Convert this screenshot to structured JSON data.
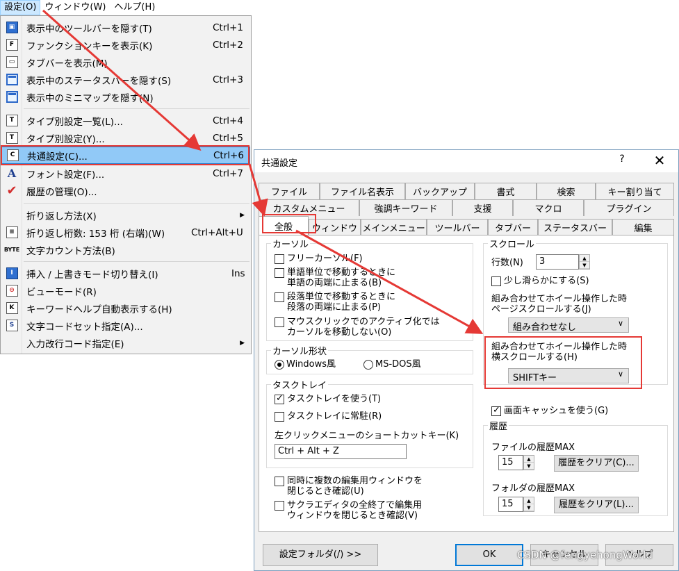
{
  "menubar": {
    "items": [
      "設定(O)",
      "ウィンドウ(W)",
      "ヘルプ(H)"
    ]
  },
  "menu": {
    "items": [
      {
        "label": "表示中のツールバーを隠す(T)",
        "shortcut": "Ctrl+1",
        "icon": "toolbar-icon"
      },
      {
        "label": "ファンクションキーを表示(K)",
        "shortcut": "Ctrl+2",
        "icon": "function-key-icon"
      },
      {
        "label": "タブバーを表示(M)",
        "shortcut": "",
        "icon": "tabbar-icon"
      },
      {
        "label": "表示中のステータスバーを隠す(S)",
        "shortcut": "Ctrl+3",
        "icon": "statusbar-icon"
      },
      {
        "label": "表示中のミニマップを隠す(N)",
        "shortcut": "",
        "icon": "minimap-icon"
      },
      {
        "label": "タイプ別設定一覧(L)...",
        "shortcut": "Ctrl+4",
        "icon": "type-settings-list-icon"
      },
      {
        "label": "タイプ別設定(Y)...",
        "shortcut": "Ctrl+5",
        "icon": "type-settings-icon"
      },
      {
        "label": "共通設定(C)...",
        "shortcut": "Ctrl+6",
        "icon": "common-settings-icon"
      },
      {
        "label": "フォント設定(F)...",
        "shortcut": "Ctrl+7",
        "icon": "font-icon"
      },
      {
        "label": "履歴の管理(O)...",
        "shortcut": "",
        "icon": "checkmark-icon"
      },
      {
        "label": "折り返し方法(X)",
        "shortcut": "",
        "icon": ""
      },
      {
        "label": "折り返し桁数: 153 桁 (右端)(W)",
        "shortcut": "Ctrl+Alt+U",
        "icon": "wrap-column-icon"
      },
      {
        "label": "文字カウント方法(B)",
        "shortcut": "",
        "icon": "byte-icon"
      },
      {
        "label": "挿入 / 上書きモード切り替え(I)",
        "shortcut": "Ins",
        "icon": "insert-mode-icon"
      },
      {
        "label": "ビューモード(R)",
        "shortcut": "",
        "icon": "view-mode-icon"
      },
      {
        "label": "キーワードヘルプ自動表示する(H)",
        "shortcut": "",
        "icon": "keyword-help-icon"
      },
      {
        "label": "文字コードセット指定(A)...",
        "shortcut": "",
        "icon": "charset-icon"
      },
      {
        "label": "入力改行コード指定(E)",
        "shortcut": "",
        "icon": ""
      }
    ]
  },
  "dialog": {
    "title": "共通設定",
    "help": "?",
    "close": "✕",
    "tabs_row1": [
      "ファイル",
      "ファイル名表示",
      "バックアップ",
      "書式",
      "検索",
      "キー割り当て"
    ],
    "tabs_row2": [
      "カスタムメニュー",
      "強調キーワード",
      "支援",
      "マクロ",
      "プラグイン"
    ],
    "tabs_row3": [
      "全般",
      "ウィンドウ",
      "メインメニュー",
      "ツールバー",
      "タブバー",
      "ステータスバー",
      "編集"
    ],
    "cursor": {
      "legend": "カーソル",
      "free_cursor": "フリーカーソル(F)",
      "word_stop_1": "単語単位で移動するときに",
      "word_stop_2": "単語の両端に止まる(B)",
      "para_stop_1": "段落単位で移動するときに",
      "para_stop_2": "段落の両端に止まる(P)",
      "mouse_1": "マウスクリックでのアクティブ化では",
      "mouse_2": "カーソルを移動しない(O)"
    },
    "cursor_shape": {
      "legend": "カーソル形状",
      "windows": "Windows風",
      "msdos": "MS-DOS風"
    },
    "tasktray": {
      "legend": "タスクトレイ",
      "use": "タスクトレイを使う(T)",
      "resident": "タスクトレイに常駐(R)",
      "shortcut_label": "左クリックメニューのショートカットキー(K)",
      "shortcut_value": "Ctrl + Alt + Z"
    },
    "close_confirm_1": "同時に複数の編集用ウィンドウを",
    "close_confirm_2": "閉じるとき確認(U)",
    "exit_confirm_1": "サクラエディタの全終了で編集用",
    "exit_confirm_2": "ウィンドウを閉じるとき確認(V)",
    "scroll": {
      "legend": "スクロール",
      "lines_label": "行数(N)",
      "lines_value": "3",
      "smooth": "少し滑らかにする(S)",
      "page_label_1": "組み合わせてホイール操作した時",
      "page_label_2": "ページスクロールする(J)",
      "page_value": "組み合わせなし",
      "horiz_label_1": "組み合わせてホイール操作した時",
      "horiz_label_2": "横スクロールする(H)",
      "horiz_value": "SHIFTキー"
    },
    "cache": "画面キャッシュを使う(G)",
    "history": {
      "legend": "履歴",
      "file_label": "ファイルの履歴MAX",
      "file_value": "15",
      "file_clear": "履歴をクリア(C)...",
      "folder_label": "フォルダの履歴MAX",
      "folder_value": "15",
      "folder_clear": "履歴をクリア(L)..."
    },
    "buttons": {
      "folder": "設定フォルダ(/) >>",
      "ok": "OK",
      "cancel": "キャンセル",
      "help": "ヘルプ"
    }
  },
  "watermark": "CSDN @fengyehongWorld",
  "colors": {
    "accent_red": "#e53935",
    "menu_highlight": "#91c9f7"
  }
}
